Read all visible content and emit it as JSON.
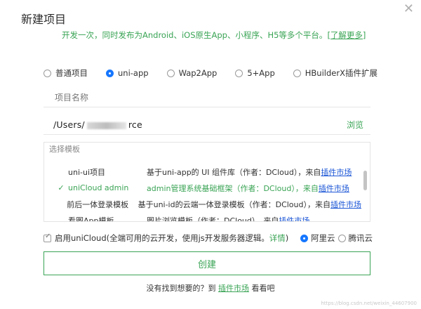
{
  "dialog": {
    "title": "新建项目",
    "close_glyph": "✕",
    "subtitle": "开发一次，同时发布为Android、iOS原生App、小程序、H5等多个平台。",
    "more_link": "[了解更多]"
  },
  "project_types": [
    {
      "label": "普通项目",
      "selected": false
    },
    {
      "label": "uni-app",
      "selected": true
    },
    {
      "label": "Wap2App",
      "selected": false
    },
    {
      "label": "5+App",
      "selected": false
    },
    {
      "label": "HBuilderX插件扩展",
      "selected": false
    }
  ],
  "name_field": {
    "placeholder": "项目名称",
    "value": ""
  },
  "path_field": {
    "prefix": "/Users/",
    "suffix": "rce",
    "browse": "浏览"
  },
  "templates": {
    "legend": "选择模板",
    "rows": [
      {
        "check": "",
        "name": "uni-ui项目",
        "desc": "基于uni-app的 UI 组件库（作者：DCloud），来自",
        "link": "插件市场",
        "selected": false
      },
      {
        "check": "✓",
        "name": "uniCloud admin",
        "desc": "admin管理系统基础框架（作者：DCloud），来自",
        "link": "插件市场",
        "selected": true
      },
      {
        "check": "",
        "name": "前后一体登录模板",
        "desc": "基于uni-id的云端一体登录模板（作者：DCloud），来自",
        "link": "插件市场",
        "selected": false
      },
      {
        "check": "",
        "name": "看图App模板",
        "desc": "图片浏览模板（作者：DCloud），来自",
        "link": "插件市场",
        "selected": false
      }
    ]
  },
  "cloud": {
    "label": "启用uniCloud(全端可用的云开发，使用js开发服务器逻辑。",
    "detail": "详情",
    "close_paren": ")",
    "providers": [
      {
        "label": "阿里云",
        "selected": true
      },
      {
        "label": "腾讯云",
        "selected": false
      }
    ]
  },
  "create_button": "创建",
  "footer": {
    "prefix": "没有找到想要的？到 ",
    "link": "插件市场",
    "suffix": " 看看吧"
  },
  "watermark": "https://blog.csdn.net/weixin_44607900",
  "colors": {
    "accent_green": "#3aa455",
    "link_blue": "#1a55d6",
    "radio_blue": "#1677ff"
  }
}
